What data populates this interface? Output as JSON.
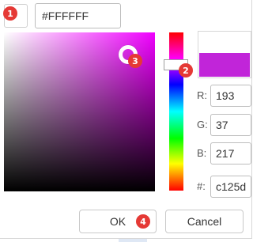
{
  "current_swatch": {
    "color": "#ffffff"
  },
  "hex_input": {
    "value": "#FFFFFF"
  },
  "picker": {
    "hue_color": "#f000ff",
    "selected_color": "#c125d9"
  },
  "fields": {
    "r": {
      "label": "R:",
      "value": "193"
    },
    "g": {
      "label": "G:",
      "value": "37"
    },
    "b": {
      "label": "B:",
      "value": "217"
    },
    "hex": {
      "label": "#:",
      "value": "c125d"
    }
  },
  "buttons": {
    "ok": "OK",
    "cancel": "Cancel"
  },
  "badges": {
    "b1": "1",
    "b2": "2",
    "b3": "3",
    "b4": "4"
  }
}
